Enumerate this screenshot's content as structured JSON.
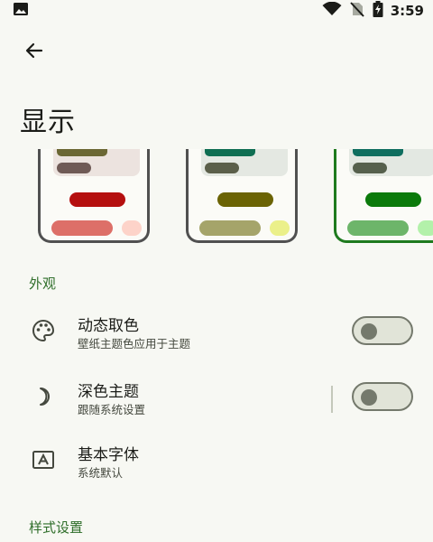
{
  "status_bar": {
    "time": "3:59",
    "icons": [
      "image-icon",
      "wifi-icon",
      "no-sim-icon",
      "battery-charging-icon"
    ]
  },
  "app_bar": {
    "back_icon": "arrow-back-icon"
  },
  "page": {
    "title": "显示"
  },
  "theme_previews": [
    {
      "name": "theme-1",
      "selected": false,
      "colors": {
        "panel": "#ece3df",
        "chip1": "#6b6734",
        "chip2": "#6f5a56",
        "bar": "#b50f0f",
        "pill": "#dd6f68",
        "dot": "#fdd3c9"
      }
    },
    {
      "name": "theme-2",
      "selected": false,
      "colors": {
        "panel": "#e4e8e2",
        "chip1": "#0f6e52",
        "chip2": "#5b5f4a",
        "bar": "#6b6304",
        "pill": "#a5a46a",
        "dot": "#ebf08a"
      }
    },
    {
      "name": "theme-3",
      "selected": true,
      "colors": {
        "panel": "#e3e8e2",
        "chip1": "#0f6e5f",
        "chip2": "#56604d",
        "bar": "#0b7a0b",
        "pill": "#6db56a",
        "dot": "#b3f1aa"
      }
    }
  ],
  "sections": {
    "appearance": "外观",
    "style": "样式设置"
  },
  "settings": {
    "dynamic_color": {
      "title": "动态取色",
      "subtitle": "壁纸主题色应用于主题",
      "icon": "palette-icon",
      "enabled": false
    },
    "dark_theme": {
      "title": "深色主题",
      "subtitle": "跟随系统设置",
      "icon": "moon-icon",
      "enabled": false
    },
    "font": {
      "title": "基本字体",
      "subtitle": "系统默认",
      "icon": "font-box-icon"
    }
  },
  "colors": {
    "accent": "#2f6e2a",
    "selected_border": "#1e7a1e",
    "background": "#f7f8f3"
  }
}
